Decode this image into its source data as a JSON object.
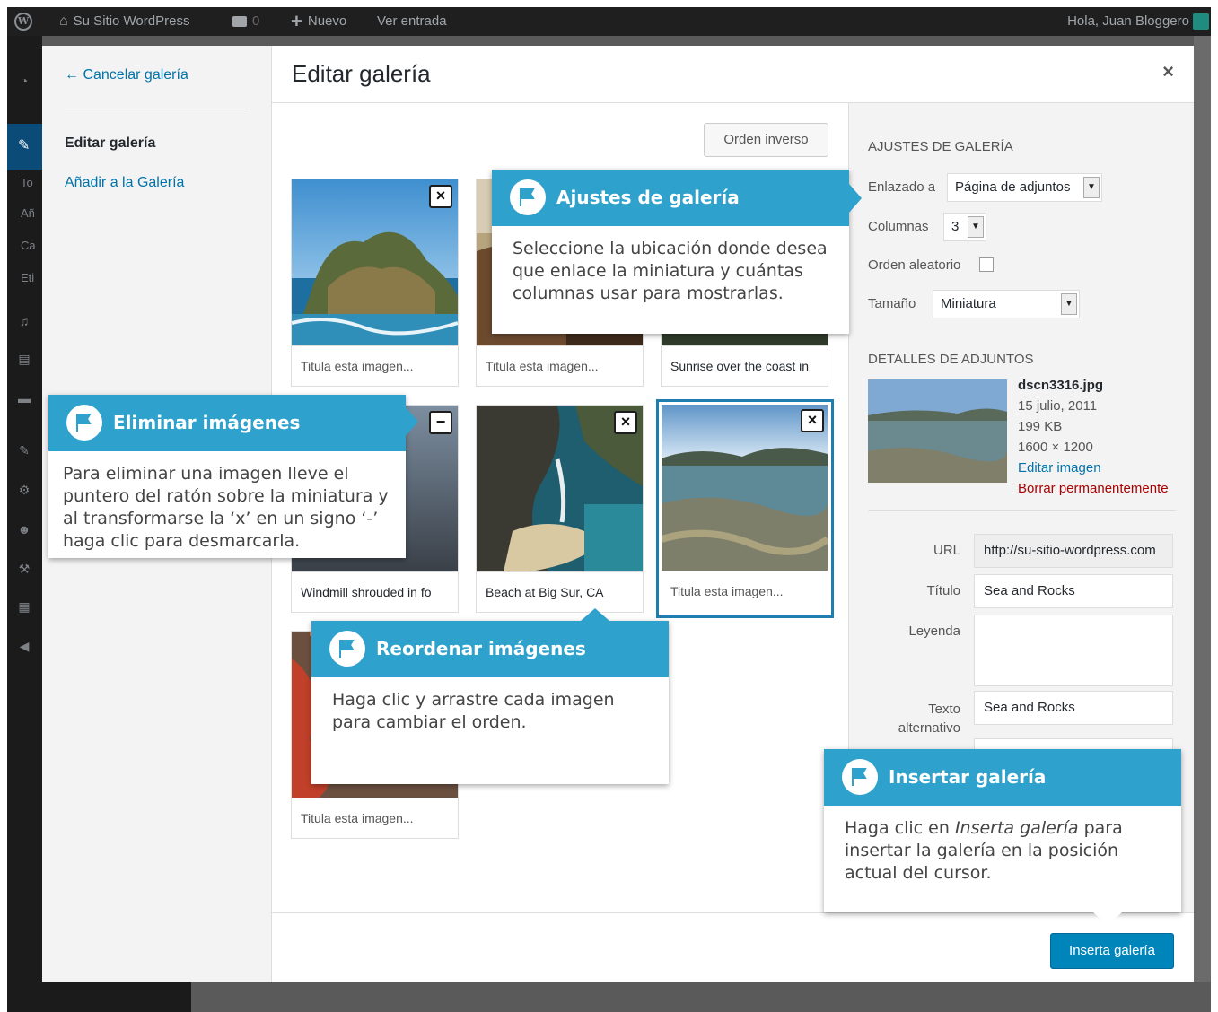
{
  "adminbar": {
    "site_name": "Su Sitio WordPress",
    "comments_count": "0",
    "new_label": "Nuevo",
    "view_entry": "Ver entrada",
    "greeting": "Hola, Juan Bloggero"
  },
  "sidebar_partial": [
    "To",
    "Añ",
    "Ca",
    "Eti"
  ],
  "menu": {
    "cancel": "← Cancelar galería",
    "edit_gallery": "Editar galería",
    "add_to_gallery": "Añadir a la Galería"
  },
  "header": {
    "title": "Editar galería",
    "close": "×"
  },
  "toolbar": {
    "reverse_order": "Orden inverso"
  },
  "attachments": [
    {
      "caption": "Titula esta imagen...",
      "placeholder": true,
      "remove": "×"
    },
    {
      "caption": "Titula esta imagen...",
      "placeholder": true,
      "remove": "×"
    },
    {
      "caption": "Sunrise over the coast in",
      "placeholder": false,
      "remove": "×"
    },
    {
      "caption": "Windmill shrouded in fo",
      "placeholder": false,
      "remove": "−"
    },
    {
      "caption": "Beach at Big Sur, CA",
      "placeholder": false,
      "remove": "×"
    },
    {
      "caption": "Titula esta imagen...",
      "placeholder": true,
      "remove": "×"
    },
    {
      "caption": "Titula esta imagen...",
      "placeholder": true,
      "remove": "×"
    }
  ],
  "gallery_settings": {
    "heading": "AJUSTES DE GALERÍA",
    "link_label": "Enlazado a",
    "link_value": "Página de adjuntos",
    "columns_label": "Columnas",
    "columns_value": "3",
    "random_label": "Orden aleatorio",
    "size_label": "Tamaño",
    "size_value": "Miniatura"
  },
  "attachment_details": {
    "heading": "DETALLES DE ADJUNTOS",
    "filename": "dscn3316.jpg",
    "date": "15 julio, 2011",
    "filesize": "199 KB",
    "dimensions": "1600 × 1200",
    "edit_link": "Editar imagen",
    "delete_link": "Borrar permanentemente",
    "url_label": "URL",
    "url_value": "http://su-sitio-wordpress.com",
    "title_label": "Título",
    "title_value": "Sea and Rocks",
    "caption_label": "Leyenda",
    "caption_value": "",
    "alt_label_1": "Texto",
    "alt_label_2": "alternativo",
    "alt_value": "Sea and Rocks"
  },
  "footer": {
    "insert_button": "Inserta galería"
  },
  "tooltips": {
    "gallery_settings": {
      "title": "Ajustes de galería",
      "body": "Seleccione la ubicación donde desea que enlace la miniatura y cuántas columnas usar para mostrarlas."
    },
    "remove_images": {
      "title": "Eliminar imágenes",
      "body": "Para eliminar una imagen lleve el puntero del ratón sobre la miniatura y al transformarse la ‘x’ en un signo ‘-’ haga clic para desmarcarla."
    },
    "reorder_images": {
      "title": "Reordenar imágenes",
      "body": "Haga clic y arrastre cada imagen para cambiar el orden."
    },
    "insert_gallery": {
      "title": "Insertar galería",
      "body_pre": "Haga clic en ",
      "body_em": "Inserta galería",
      "body_post": " para insertar la galería en la posición actual del cursor."
    }
  },
  "colors": {
    "accent": "#2ea2cc",
    "primary_button": "#0085ba",
    "link": "#0073aa",
    "danger": "#a00",
    "selected_border": "#1e7eb0"
  },
  "icons": [
    "wordpress-logo-icon",
    "home-icon",
    "comment-icon",
    "plus-icon",
    "flag-icon",
    "close-icon",
    "remove-icon",
    "chevron-down-icon"
  ]
}
